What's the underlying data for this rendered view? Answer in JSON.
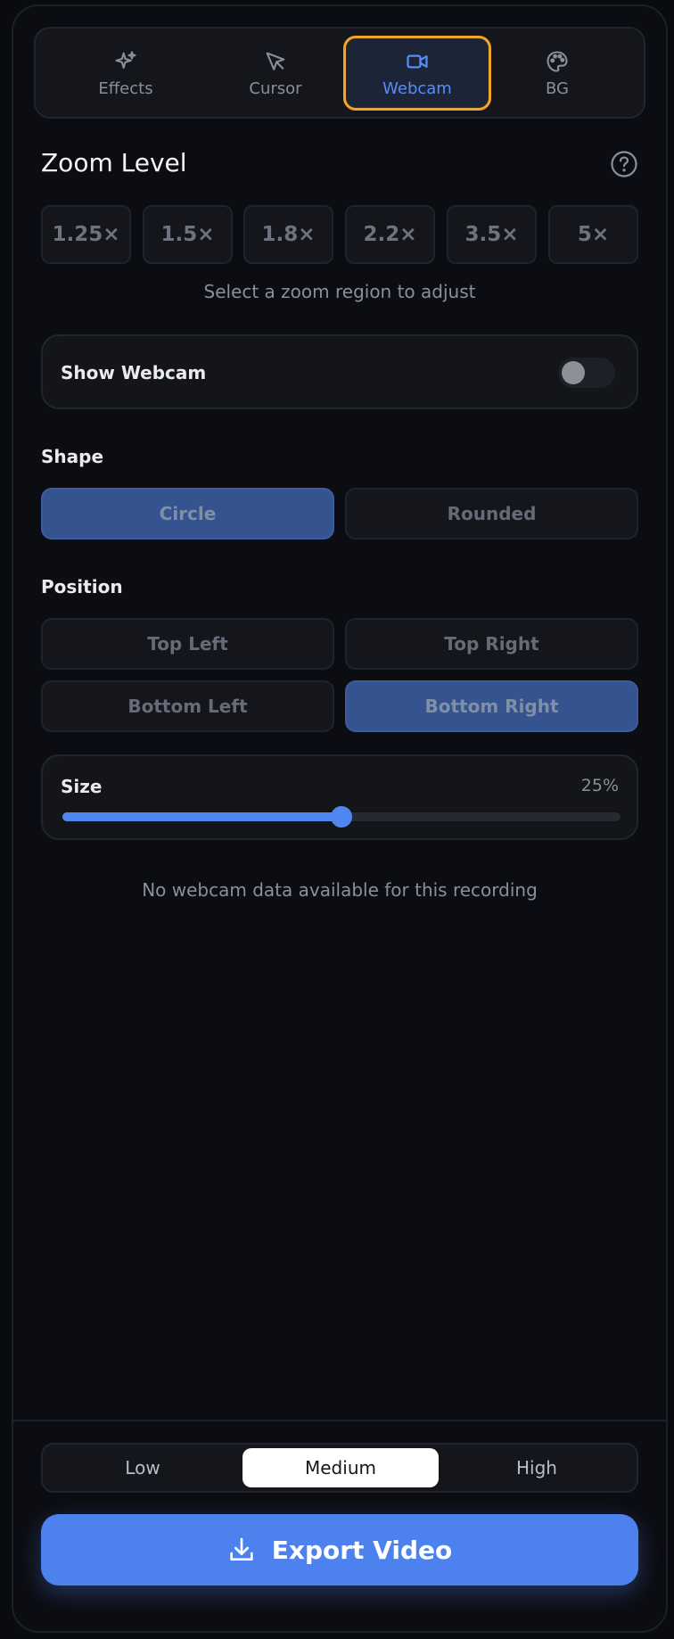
{
  "tabs": [
    {
      "label": "Effects",
      "icon": "sparkles-icon",
      "active": false
    },
    {
      "label": "Cursor",
      "icon": "cursor-icon",
      "active": false
    },
    {
      "label": "Webcam",
      "icon": "video-camera-icon",
      "active": true
    },
    {
      "label": "BG",
      "icon": "palette-icon",
      "active": false
    }
  ],
  "zoom": {
    "title": "Zoom Level",
    "levels": [
      "1.25×",
      "1.5×",
      "1.8×",
      "2.2×",
      "3.5×",
      "5×"
    ],
    "hint": "Select a zoom region to adjust"
  },
  "webcam": {
    "show_label": "Show Webcam",
    "show_enabled": false
  },
  "shape": {
    "label": "Shape",
    "options": [
      "Circle",
      "Rounded"
    ],
    "selected": "Circle"
  },
  "position": {
    "label": "Position",
    "options": [
      "Top Left",
      "Top Right",
      "Bottom Left",
      "Bottom Right"
    ],
    "selected": "Bottom Right"
  },
  "size": {
    "label": "Size",
    "value_text": "25%",
    "slider_fraction": 0.5
  },
  "no_data_message": "No webcam data available for this recording",
  "quality": {
    "options": [
      "Low",
      "Medium",
      "High"
    ],
    "selected": "Medium"
  },
  "export": {
    "label": "Export Video"
  },
  "colors": {
    "accent": "#4d82ee",
    "active_tab_border": "#f1a62b",
    "selected_segment": "#34538f"
  }
}
